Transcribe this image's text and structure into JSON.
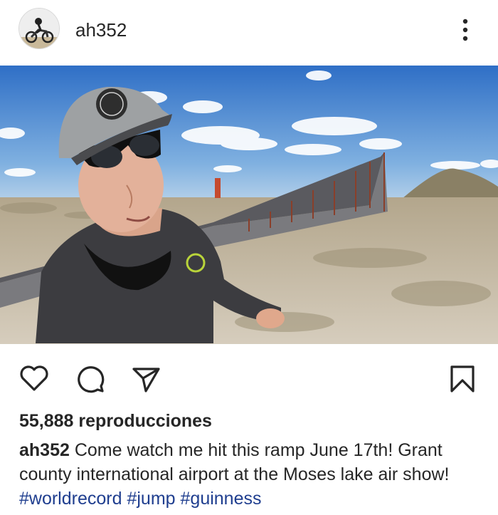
{
  "post": {
    "username": "ah352",
    "views_label": "55,888 reproducciones",
    "caption": {
      "username": "ah352",
      "text": "Come watch me hit this ramp June 17th! Grant county international airport at the Moses lake air show!",
      "hashtags": [
        "#worldrecord",
        "#jump",
        "#guinness"
      ]
    }
  },
  "icons": {
    "more": "more-options-icon",
    "like": "heart-icon",
    "comment": "comment-bubble-icon",
    "share": "paper-plane-icon",
    "save": "bookmark-icon"
  },
  "colors": {
    "text": "#262626",
    "hashtag": "#1f3e8f",
    "background": "#ffffff"
  }
}
